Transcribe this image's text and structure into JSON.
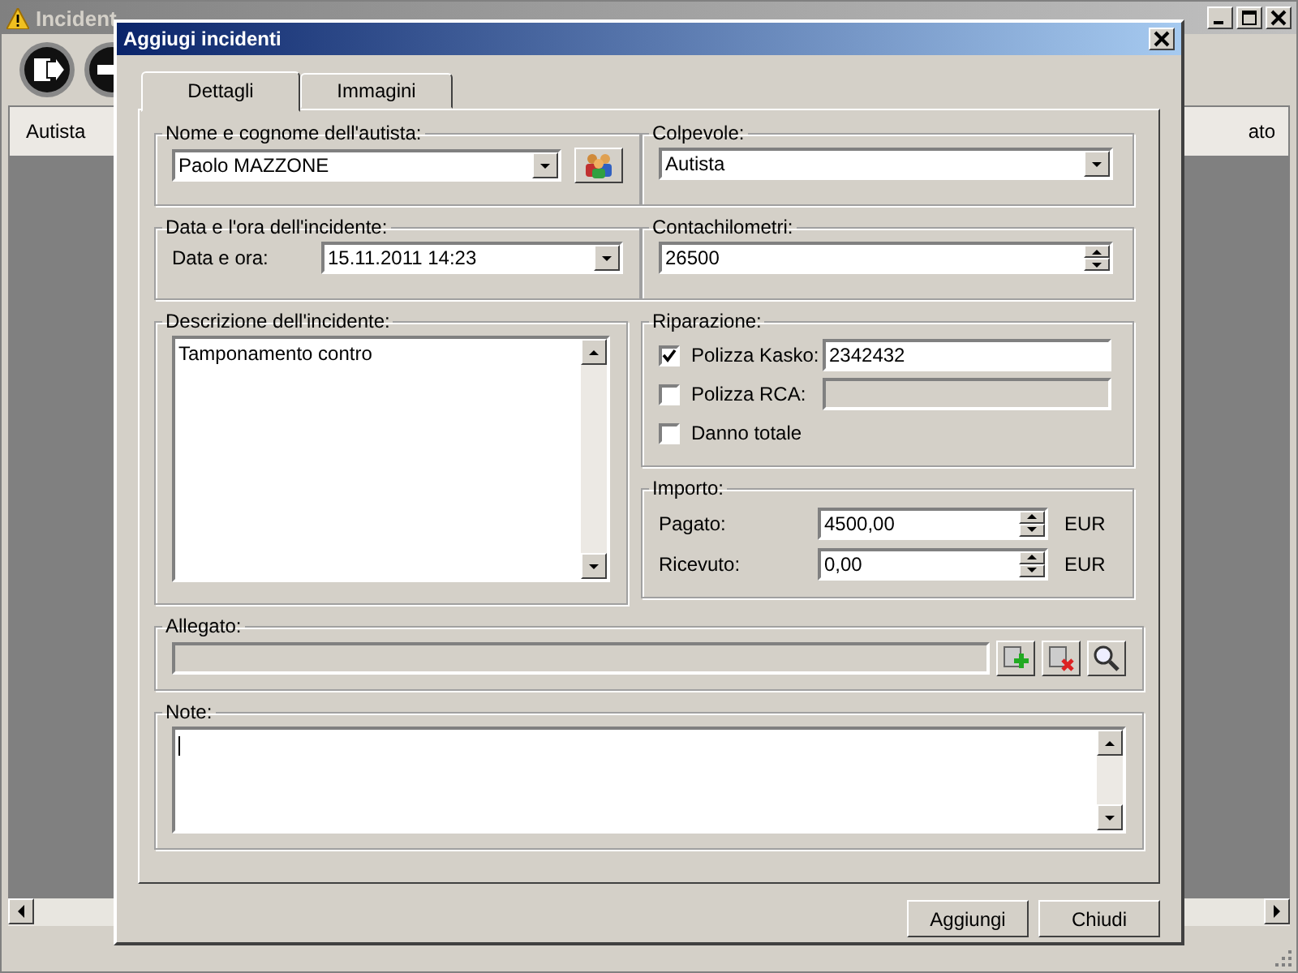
{
  "main_window": {
    "title": "Incident",
    "columns": [
      "Autista",
      "ato"
    ]
  },
  "dialog": {
    "title": "Aggiugi incidenti",
    "tabs": [
      {
        "label": "Dettagli",
        "selected": true
      },
      {
        "label": "Immagini",
        "selected": false
      }
    ],
    "driver": {
      "legend": "Nome e cognome dell'autista:",
      "value": "Paolo MAZZONE"
    },
    "culprit": {
      "legend": "Colpevole:",
      "value": "Autista"
    },
    "date": {
      "legend": "Data e l'ora dell'incidente:",
      "label": "Data e ora:",
      "value": "15.11.2011 14:23"
    },
    "odometer": {
      "legend": "Contachilometri:",
      "value": "26500"
    },
    "description": {
      "legend": "Descrizione dell'incidente:",
      "value": "Tamponamento contro"
    },
    "repair": {
      "legend": "Riparazione:",
      "options": [
        {
          "kind": "field",
          "label": "Polizza Kasko:",
          "checked": true,
          "disabled": false,
          "value": "2342432"
        },
        {
          "kind": "field",
          "label": "Polizza RCA:",
          "checked": false,
          "disabled": true
        },
        {
          "kind": "plain",
          "label": "Danno totale",
          "checked": false
        }
      ]
    },
    "amount": {
      "legend": "Importo:",
      "rows": [
        {
          "label": "Pagato:",
          "value": "4500,00",
          "unit": "EUR"
        },
        {
          "label": "Ricevuto:",
          "value": "0,00",
          "unit": "EUR"
        }
      ]
    },
    "attachment": {
      "legend": "Allegato:"
    },
    "notes": {
      "legend": "Note:"
    },
    "buttons": [
      "Aggiungi",
      "Chiudi"
    ]
  }
}
